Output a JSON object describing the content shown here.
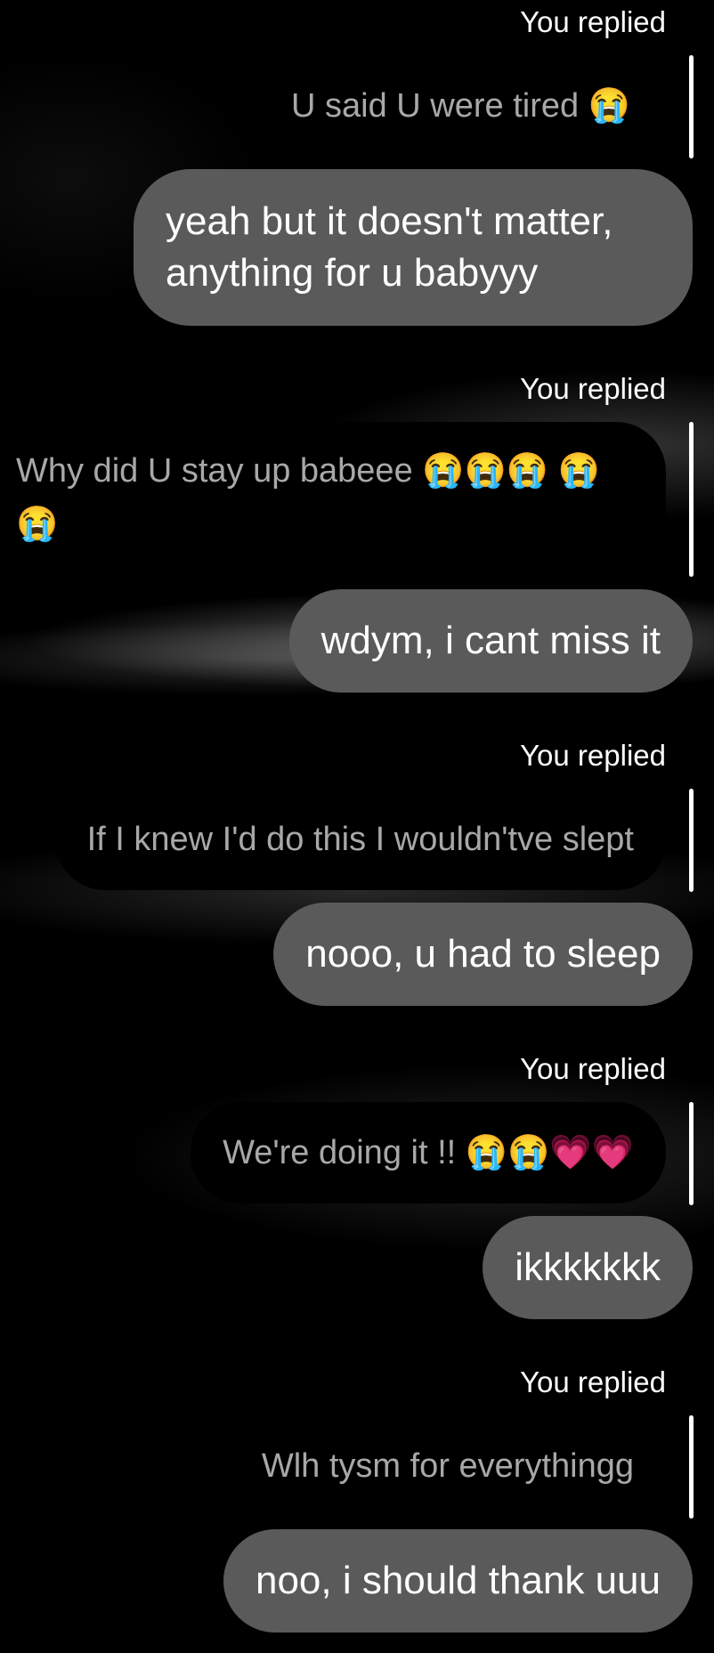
{
  "conversation": {
    "replies": [
      {
        "label": "You replied",
        "quoted": "U said U were tired 😭",
        "message": "yeah but it doesn't matter, anything for u babyyy"
      },
      {
        "label": "You replied",
        "quoted": "Why did U stay up babeee 😭😭😭 😭😭",
        "message": "wdym, i cant miss it"
      },
      {
        "label": "You replied",
        "quoted": "If I knew I'd do this I wouldn'tve slept",
        "message": "nooo, u had to sleep"
      },
      {
        "label": "You replied",
        "quoted": "We're doing it !! 😭😭💗💗",
        "message": "ikkkkkkk"
      },
      {
        "label": "You replied",
        "quoted": "Wlh tysm for everythingg",
        "message": "noo, i should thank uuu"
      }
    ]
  },
  "colors": {
    "background": "#000000",
    "sent_bubble": "#5a5a5a",
    "quoted_text": "#a8a8a8",
    "quote_bar": "#ffffff",
    "label_text": "#ffffff"
  }
}
